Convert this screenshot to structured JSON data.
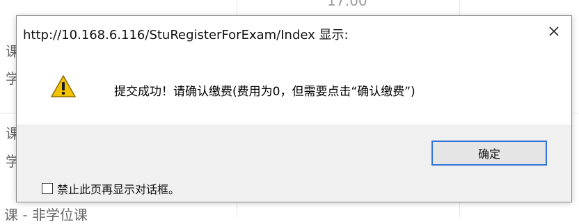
{
  "background": {
    "top_time": "17:00",
    "left_edge_chars": [
      "课",
      "学",
      "课",
      "学"
    ],
    "bottom_text": "课 - 非学位课"
  },
  "dialog": {
    "title": "http://10.168.6.116/StuRegisterForExam/Index 显示:",
    "close_icon": "close-icon",
    "warning_icon": "warning-icon",
    "message": "提交成功！请确认缴费(费用为0，但需要点击“确认缴费”)",
    "ok_button_label": "确定",
    "checkbox_label": "禁止此页再显示对话框。",
    "checkbox_checked": false
  },
  "colors": {
    "accent_border": "#3375d6",
    "warning_yellow": "#f3c300",
    "footer_bg": "#f0f0f0"
  }
}
